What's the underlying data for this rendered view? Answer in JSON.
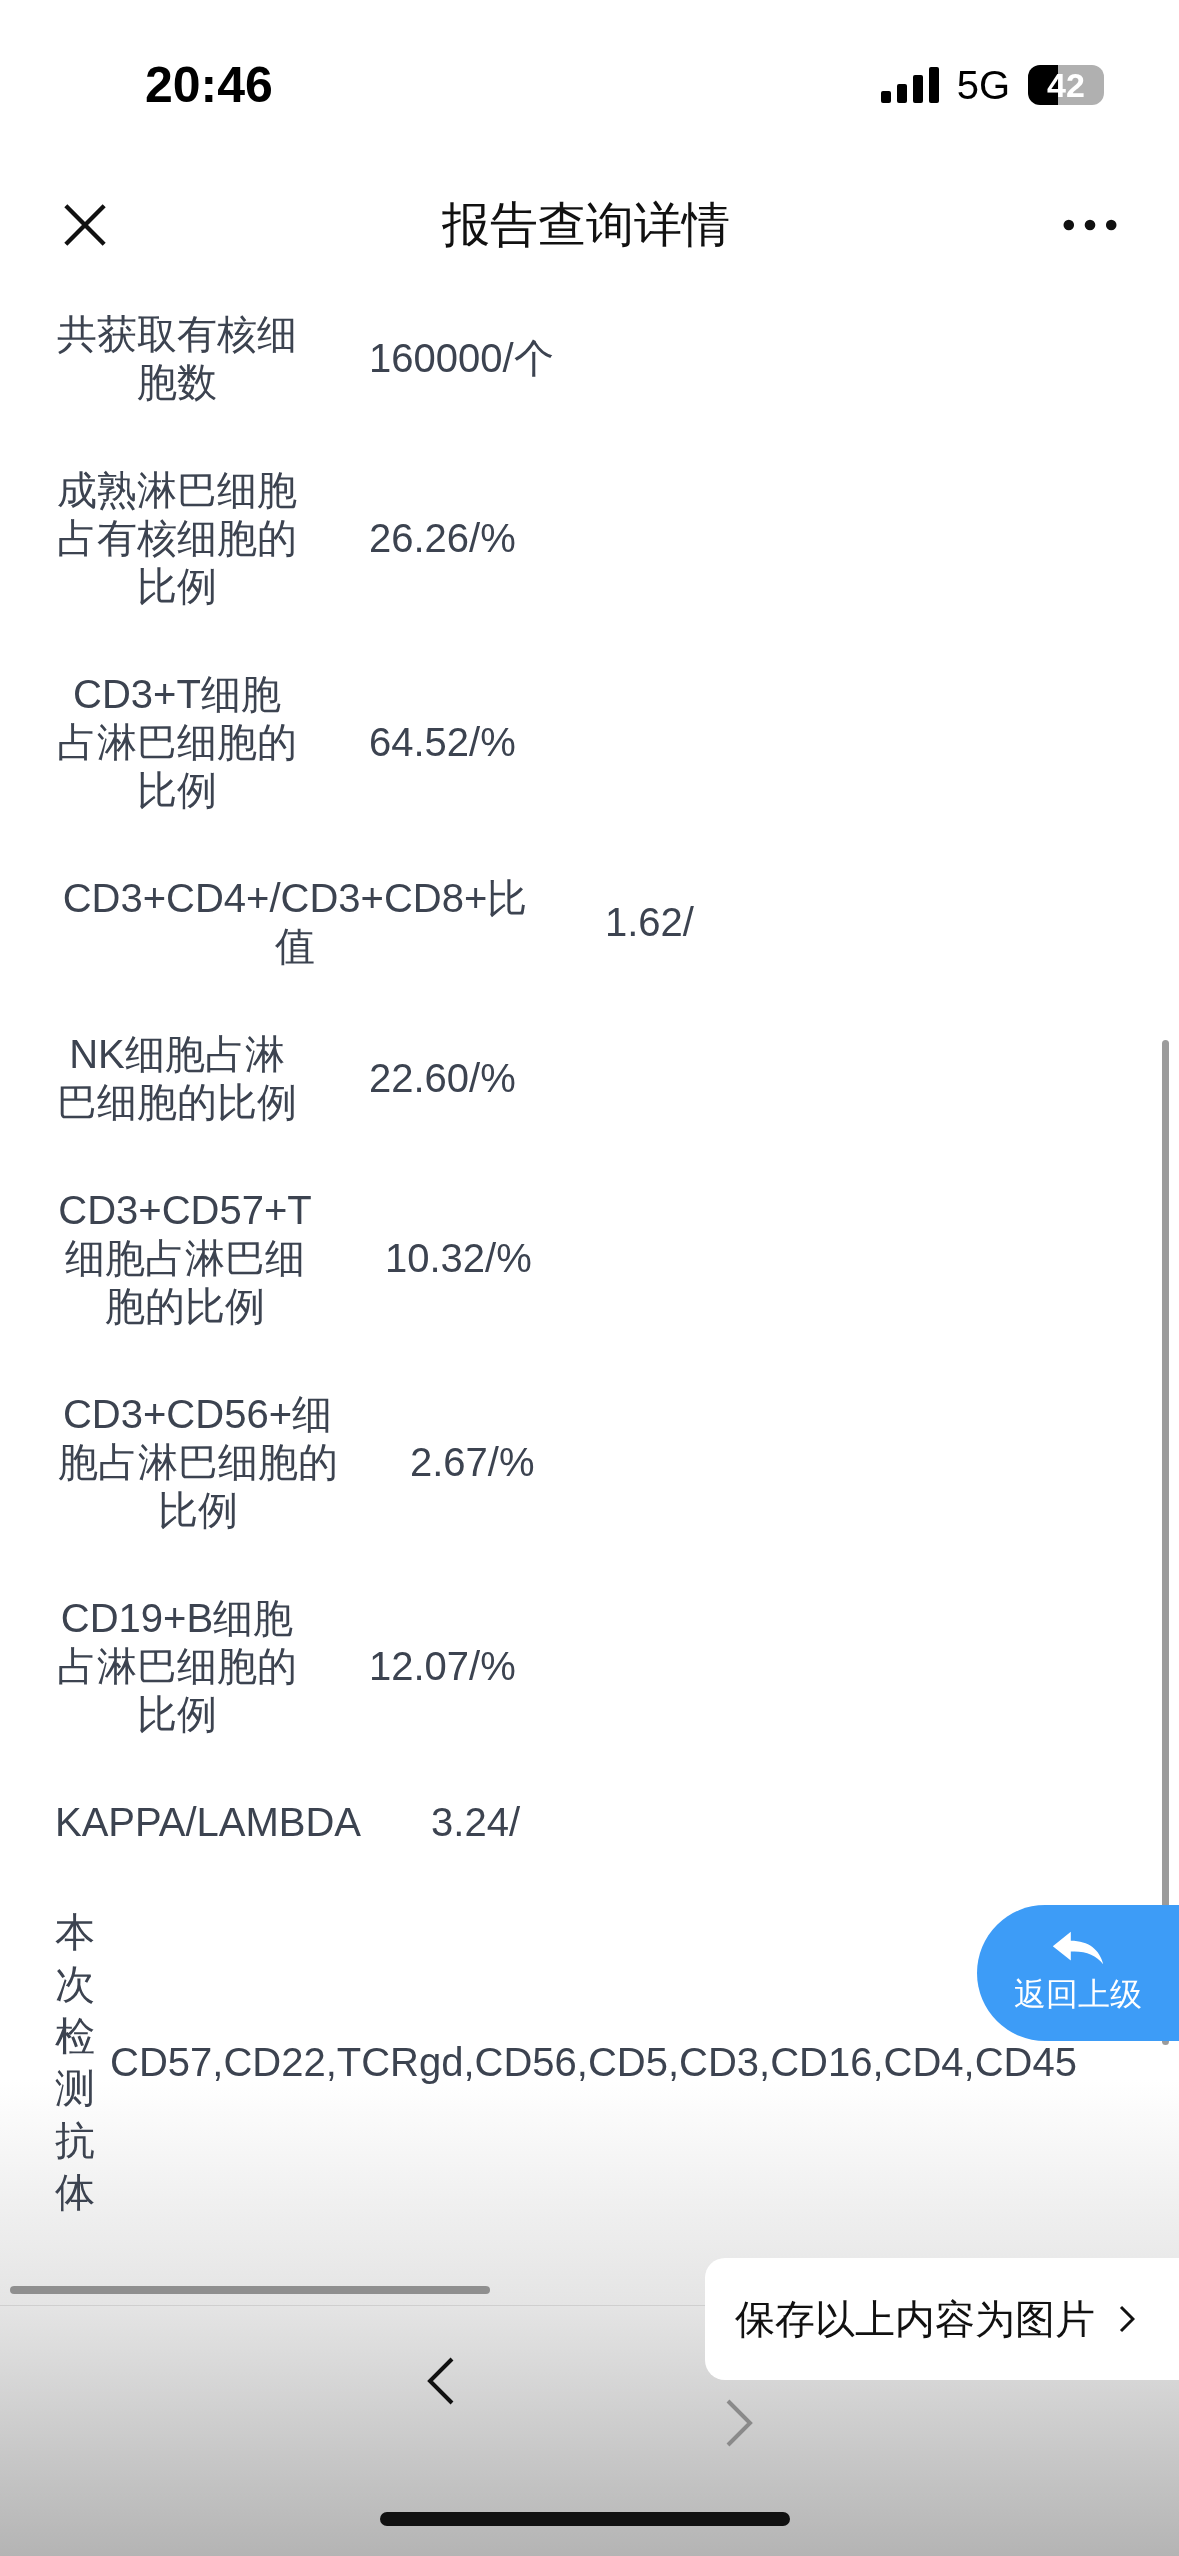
{
  "status_bar": {
    "time": "20:46",
    "network": "5G",
    "battery": "42"
  },
  "header": {
    "title": "报告查询详情"
  },
  "rows": [
    {
      "kind": "text",
      "label": "共获取有核细胞数",
      "value": "160000/个"
    },
    {
      "kind": "text",
      "label": "成熟淋巴细胞占有核细胞的比例",
      "value": "26.26/%"
    },
    {
      "kind": "text",
      "label": "CD3+T细胞占淋巴细胞的比例",
      "value": "64.52/%"
    },
    {
      "kind": "text",
      "label": "CD3+CD4+/CD3+CD8+比值",
      "value": "1.62/"
    },
    {
      "kind": "text",
      "label": "NK细胞占淋巴细胞的比例",
      "value": "22.60/%"
    },
    {
      "kind": "text",
      "label": "CD3+CD57+T细胞占淋巴细胞的比例",
      "value": "10.32/%"
    },
    {
      "kind": "text",
      "label": "CD3+CD56+细胞占淋巴细胞的比例",
      "value": "2.67/%"
    },
    {
      "kind": "text",
      "label": "CD19+B细胞占淋巴细胞的比例",
      "value": "12.07/%"
    },
    {
      "kind": "text",
      "label": "KAPPA/LAMBDA",
      "value": "3.24/"
    },
    {
      "kind": "vertical",
      "label": "本次检测抗体",
      "value": "CD57,CD22,TCRgd,CD56,CD5,CD3,CD16,CD4,CD45"
    }
  ],
  "back_button": {
    "label": "返回上级"
  },
  "save_popup": {
    "label": "保存以上内容为图片"
  },
  "toolbar": [
    {
      "kind": "back",
      "disabled": false
    },
    {
      "kind": "forward",
      "disabled": true
    }
  ]
}
